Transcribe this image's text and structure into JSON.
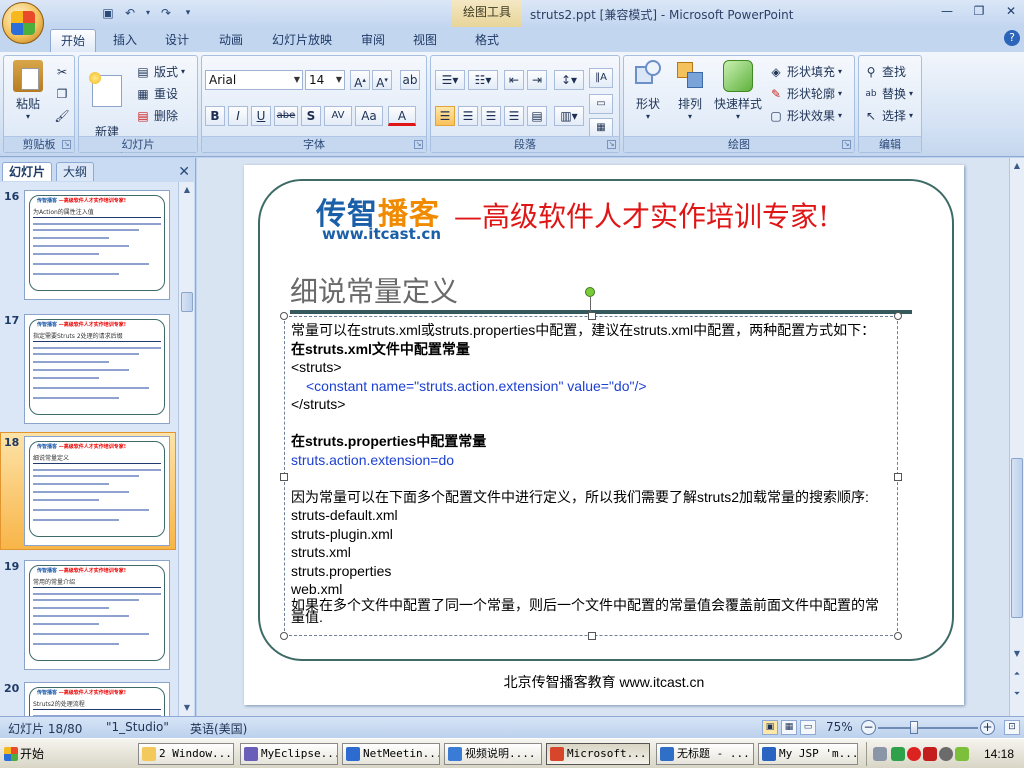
{
  "window": {
    "title": "struts2.ppt [兼容模式] - Microsoft PowerPoint",
    "contextual_tab_group": "绘图工具"
  },
  "ribbon_tabs": [
    "开始",
    "插入",
    "设计",
    "动画",
    "幻灯片放映",
    "审阅",
    "视图",
    "格式"
  ],
  "ribbon": {
    "clipboard": {
      "label": "剪贴板",
      "paste": "粘贴"
    },
    "slides": {
      "label": "幻灯片",
      "new_slide": "新建\n幻灯片",
      "layout": "版式",
      "reset": "重设",
      "delete": "删除"
    },
    "font": {
      "label": "字体",
      "font_name": "Arial",
      "font_size": "14",
      "bold": "B",
      "italic": "I",
      "underline": "U",
      "strike": "abe",
      "shadow": "S",
      "spacing": "AV",
      "case": "Aa",
      "color": "A"
    },
    "paragraph": {
      "label": "段落"
    },
    "drawing": {
      "label": "绘图",
      "shapes": "形状",
      "arrange": "排列",
      "quick_styles": "快速样式",
      "shape_fill": "形状填充",
      "shape_outline": "形状轮廓",
      "shape_effects": "形状效果"
    },
    "editing": {
      "label": "编辑",
      "find": "查找",
      "replace": "替换",
      "select": "选择"
    }
  },
  "left_panel": {
    "tab_slides": "幻灯片",
    "tab_outline": "大纲",
    "thumbnails": [
      {
        "num": "16",
        "title": "为Action的属性注入值"
      },
      {
        "num": "17",
        "title": "指定需要Struts 2处理的请求后缀"
      },
      {
        "num": "18",
        "title": "细说常量定义"
      },
      {
        "num": "19",
        "title": "常用的常量介绍"
      },
      {
        "num": "20",
        "title": "Struts2的处理流程"
      }
    ],
    "selected_index": 2,
    "thumb_header_a": "传智播客",
    "thumb_header_b": "—高级软件人才实作培训专家!"
  },
  "slide": {
    "logo_a": "传智",
    "logo_b": "播客",
    "logo_url": "www.itcast.cn",
    "slogan": "—高级软件人才实作培训专家!",
    "title": "细说常量定义",
    "lines": [
      "常量可以在struts.xml或struts.properties中配置，建议在struts.xml中配置，两种配置方式如下：",
      "在struts.xml文件中配置常量",
      "<struts>",
      "<constant name=\"struts.action.extension\" value=\"do\"/>",
      "</struts>",
      "",
      "在struts.properties中配置常量",
      "struts.action.extension=do",
      "",
      "因为常量可以在下面多个配置文件中进行定义，所以我们需要了解struts2加载常量的搜索顺序:",
      "struts-default.xml",
      "struts-plugin.xml",
      "struts.xml",
      "struts.properties",
      "web.xml",
      "如果在多个文件中配置了同一个常量，则后一个文件中配置的常量值会覆盖前面文件中配置的常量值."
    ],
    "footer": "北京传智播客教育 www.itcast.cn"
  },
  "statusbar": {
    "slide_info": "幻灯片 18/80",
    "theme": "\"1_Studio\"",
    "language": "英语(美国)",
    "zoom": "75%",
    "zoom_level_percent": 75
  },
  "taskbar": {
    "start": "开始",
    "tasks": [
      {
        "label": "2 Window...",
        "color": "#f2c95a"
      },
      {
        "label": "MyEclipse...",
        "color": "#6a5fb8"
      },
      {
        "label": "NetMeetin...",
        "color": "#2e6bd0"
      },
      {
        "label": "视频说明....",
        "color": "#3a7bd6"
      },
      {
        "label": "Microsoft...",
        "color": "#d7452b"
      },
      {
        "label": "无标题 - ...",
        "color": "#2f6fc8"
      },
      {
        "label": "My JSP 'm...",
        "color": "#2a64c0"
      }
    ],
    "active_task": 4,
    "clock": "14:18"
  }
}
